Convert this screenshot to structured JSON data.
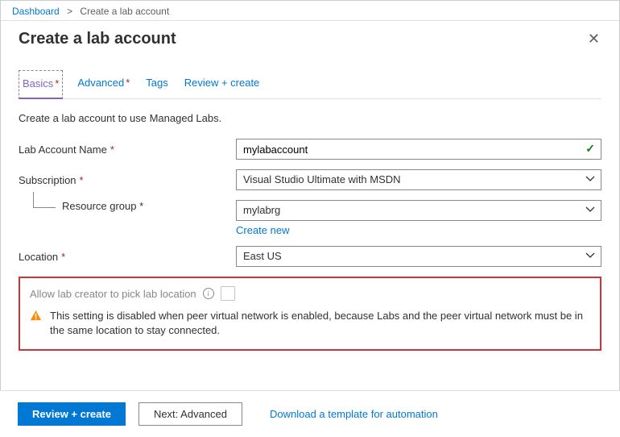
{
  "breadcrumb": {
    "root": "Dashboard",
    "current": "Create a lab account"
  },
  "header": {
    "title": "Create a lab account"
  },
  "tabs": {
    "basics": "Basics",
    "advanced": "Advanced",
    "tags": "Tags",
    "review": "Review + create"
  },
  "intro": "Create a lab account to use Managed Labs.",
  "form": {
    "labAccountName": {
      "label": "Lab Account Name",
      "value": "mylabaccount"
    },
    "subscription": {
      "label": "Subscription",
      "value": "Visual Studio Ultimate with MSDN"
    },
    "resourceGroup": {
      "label": "Resource group",
      "value": "mylabrg",
      "createNew": "Create new"
    },
    "location": {
      "label": "Location",
      "value": "East US"
    }
  },
  "callout": {
    "title": "Allow lab creator to pick lab location",
    "message": "This setting is disabled when peer virtual network is enabled, because Labs and the peer virtual network must be in the same location to stay connected."
  },
  "footer": {
    "primary": "Review + create",
    "secondary": "Next: Advanced",
    "link": "Download a template for automation"
  }
}
